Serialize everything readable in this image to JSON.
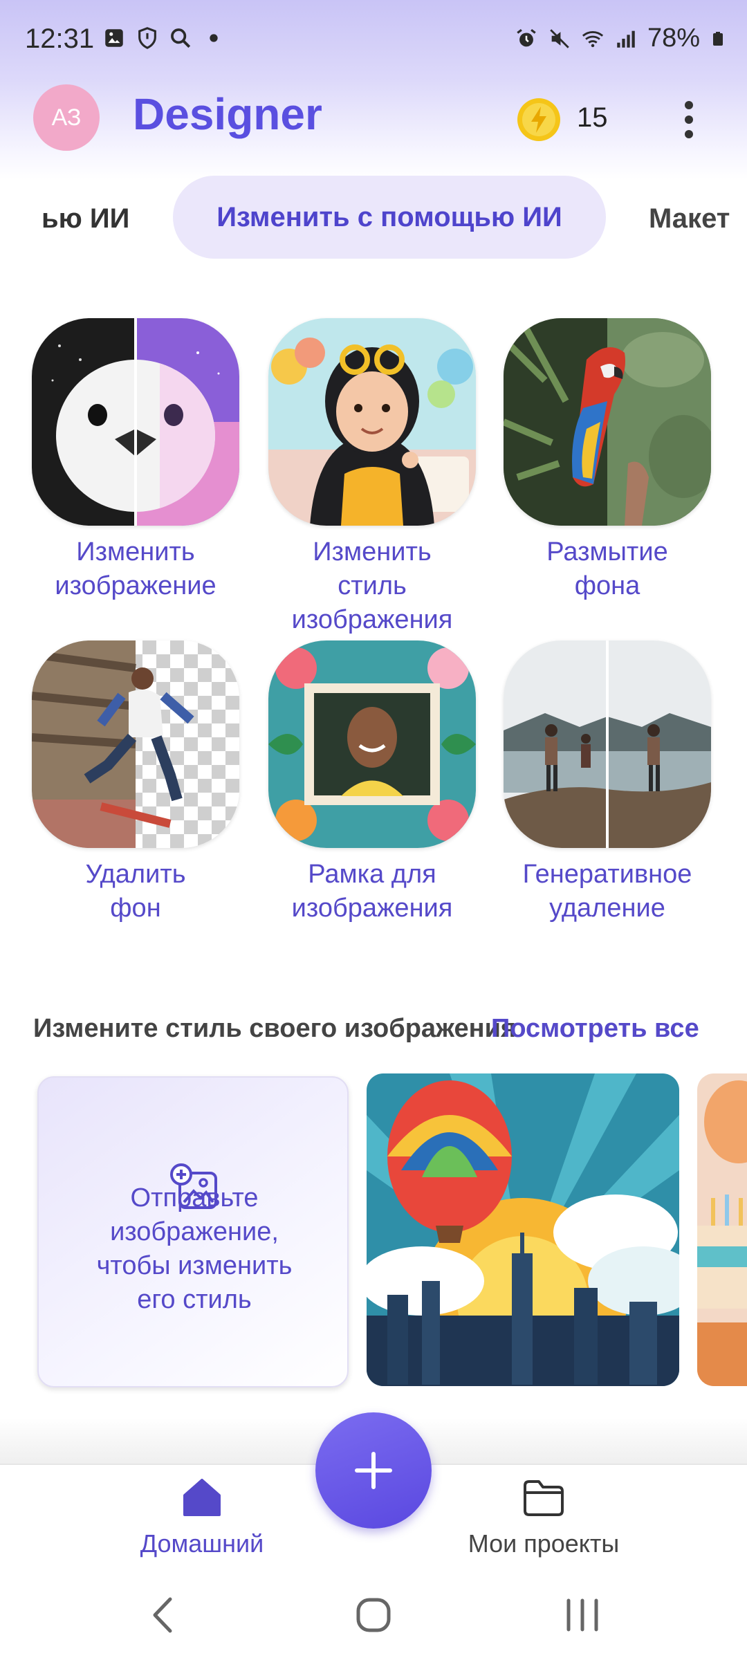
{
  "status_bar": {
    "time": "12:31",
    "battery": "78%"
  },
  "header": {
    "avatar_initials": "АЗ",
    "title": "Designer",
    "coins": "15"
  },
  "tabs": {
    "prev_label": "ью ИИ",
    "active_label": "Изменить с помощью ИИ",
    "next_label": "Макет"
  },
  "tools": [
    {
      "label_line1": "Изменить",
      "label_line2": "изображение",
      "label_line3": ""
    },
    {
      "label_line1": "Изменить",
      "label_line2": "стиль",
      "label_line3": "изображения"
    },
    {
      "label_line1": "Размытие",
      "label_line2": "фона",
      "label_line3": ""
    },
    {
      "label_line1": "Удалить",
      "label_line2": "фон",
      "label_line3": ""
    },
    {
      "label_line1": "Рамка для",
      "label_line2": "изображения",
      "label_line3": ""
    },
    {
      "label_line1": "Генеративное",
      "label_line2": "удаление",
      "label_line3": ""
    }
  ],
  "section": {
    "title": "Измените стиль своего изображения",
    "see_all": "Посмотреть все",
    "upload_line1": "Отправьте",
    "upload_line2": "изображение,",
    "upload_line3": "чтобы изменить",
    "upload_line4": "его стиль"
  },
  "bottom_nav": {
    "home_label": "Домашний",
    "projects_label": "Мои проекты"
  },
  "colors": {
    "accent": "#5a4fe0",
    "nav_active": "#5549c9",
    "nav_inactive": "#444444"
  }
}
